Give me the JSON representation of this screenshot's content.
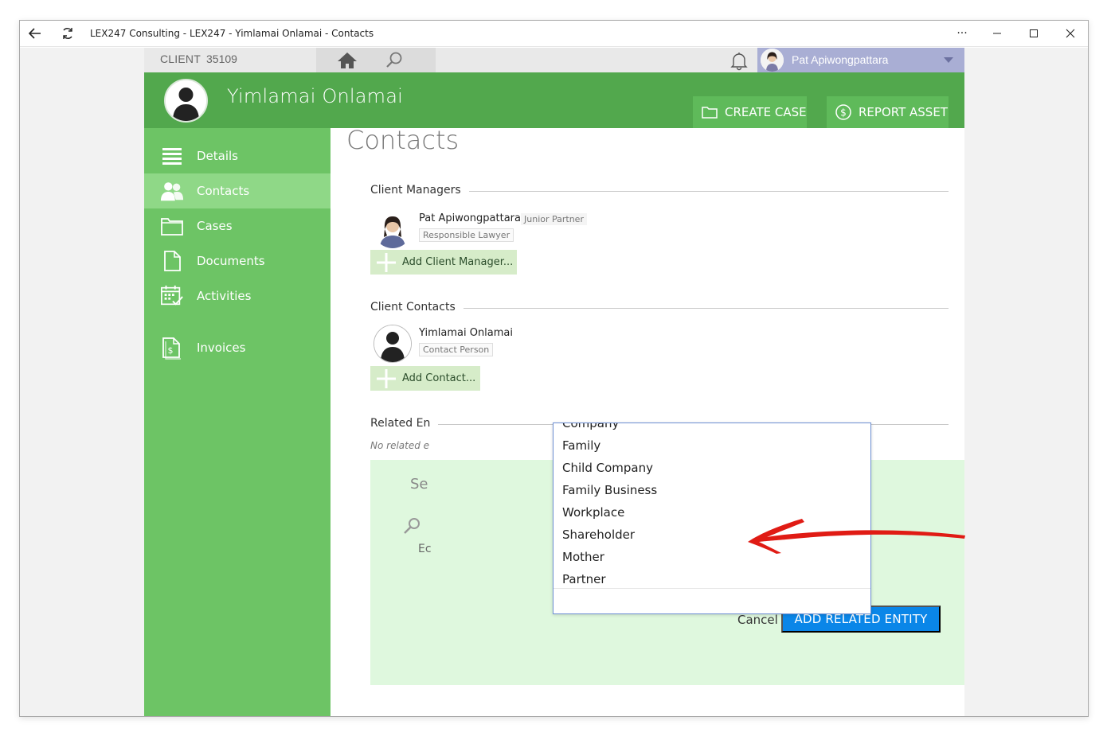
{
  "window": {
    "title": "LEX247 Consulting - LEX247 - Yimlamai Onlamai - Contacts",
    "controls": [
      "more-icon",
      "minimize-icon",
      "maximize-icon",
      "close-icon"
    ]
  },
  "topbar": {
    "client_label": "CLIENT",
    "client_id": "35109",
    "user_name": "Pat Apiwongpattara"
  },
  "header": {
    "client_name": "Yimlamai Onlamai",
    "create_case_label": "CREATE CASE",
    "report_asset_label": "REPORT ASSET"
  },
  "sidebar": {
    "items": [
      {
        "label": "Details",
        "icon": "list-icon"
      },
      {
        "label": "Contacts",
        "icon": "people-icon"
      },
      {
        "label": "Cases",
        "icon": "folder-icon"
      },
      {
        "label": "Documents",
        "icon": "document-icon"
      },
      {
        "label": "Activities",
        "icon": "calendar-icon"
      },
      {
        "label": "Invoices",
        "icon": "invoice-icon"
      }
    ],
    "active": "Contacts"
  },
  "main": {
    "title": "Contacts",
    "client_managers": {
      "heading": "Client Managers",
      "person": {
        "name": "Pat Apiwongpattara",
        "role": "Junior Partner",
        "tag": "Responsible Lawyer"
      },
      "add_label": "Add Client Manager..."
    },
    "client_contacts": {
      "heading": "Client Contacts",
      "person": {
        "name": "Yimlamai Onlamai",
        "tag": "Contact Person"
      },
      "add_label": "Add Contact..."
    },
    "related": {
      "heading": "Related En",
      "empty_text": "No related e"
    },
    "panel": {
      "select_text": "Se",
      "edit_text": "Ec",
      "cancel_label": "Cancel",
      "add_related_label": "ADD RELATED ENTITY"
    }
  },
  "dropdown": {
    "options": [
      "Company",
      "Family",
      "Child Company",
      "Family Business",
      "Workplace",
      "Shareholder",
      "Mother",
      "Partner"
    ]
  },
  "colors": {
    "header_green": "#52a84d",
    "sidebar_green": "#6dc465",
    "active_nav": "#8fd887",
    "primary_blue": "#0a86e8",
    "annotation_red": "#e01b14"
  }
}
